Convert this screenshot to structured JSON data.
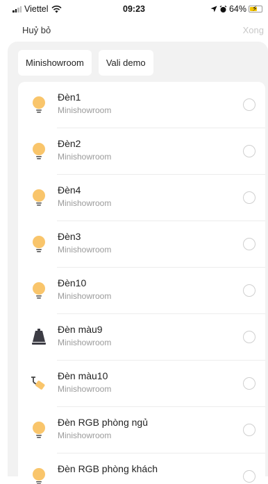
{
  "status_bar": {
    "carrier": "Viettel",
    "time": "09:23",
    "battery": "64%",
    "battery_level": 0.64,
    "icons": [
      "signal-icon",
      "wifi-icon",
      "location-icon",
      "alarm-icon",
      "battery-icon"
    ]
  },
  "topbar": {
    "cancel_label": "Huỷ bỏ",
    "done_label": "Xong"
  },
  "rooms": [
    {
      "label": "Minishowroom"
    },
    {
      "label": "Vali demo"
    }
  ],
  "devices": [
    {
      "name": "Đèn1",
      "room": "Minishowroom",
      "icon": "bulb-icon"
    },
    {
      "name": "Đèn2",
      "room": "Minishowroom",
      "icon": "bulb-icon"
    },
    {
      "name": "Đèn4",
      "room": "Minishowroom",
      "icon": "bulb-icon"
    },
    {
      "name": "Đèn3",
      "room": "Minishowroom",
      "icon": "bulb-icon"
    },
    {
      "name": "Đèn10",
      "room": "Minishowroom",
      "icon": "bulb-icon"
    },
    {
      "name": "Đèn màu9",
      "room": "Minishowroom",
      "icon": "lamp-shade-icon"
    },
    {
      "name": "Đèn màu10",
      "room": "Minishowroom",
      "icon": "spotlight-icon"
    },
    {
      "name": "Đèn RGB phòng ngủ",
      "room": "Minishowroom",
      "icon": "bulb-icon"
    },
    {
      "name": "Đèn RGB phòng khách",
      "room": "",
      "icon": "bulb-icon"
    }
  ],
  "colors": {
    "bulb": "#f9c56b",
    "panel_bg": "#f2f2f2",
    "done_disabled": "#c8c8c8"
  }
}
